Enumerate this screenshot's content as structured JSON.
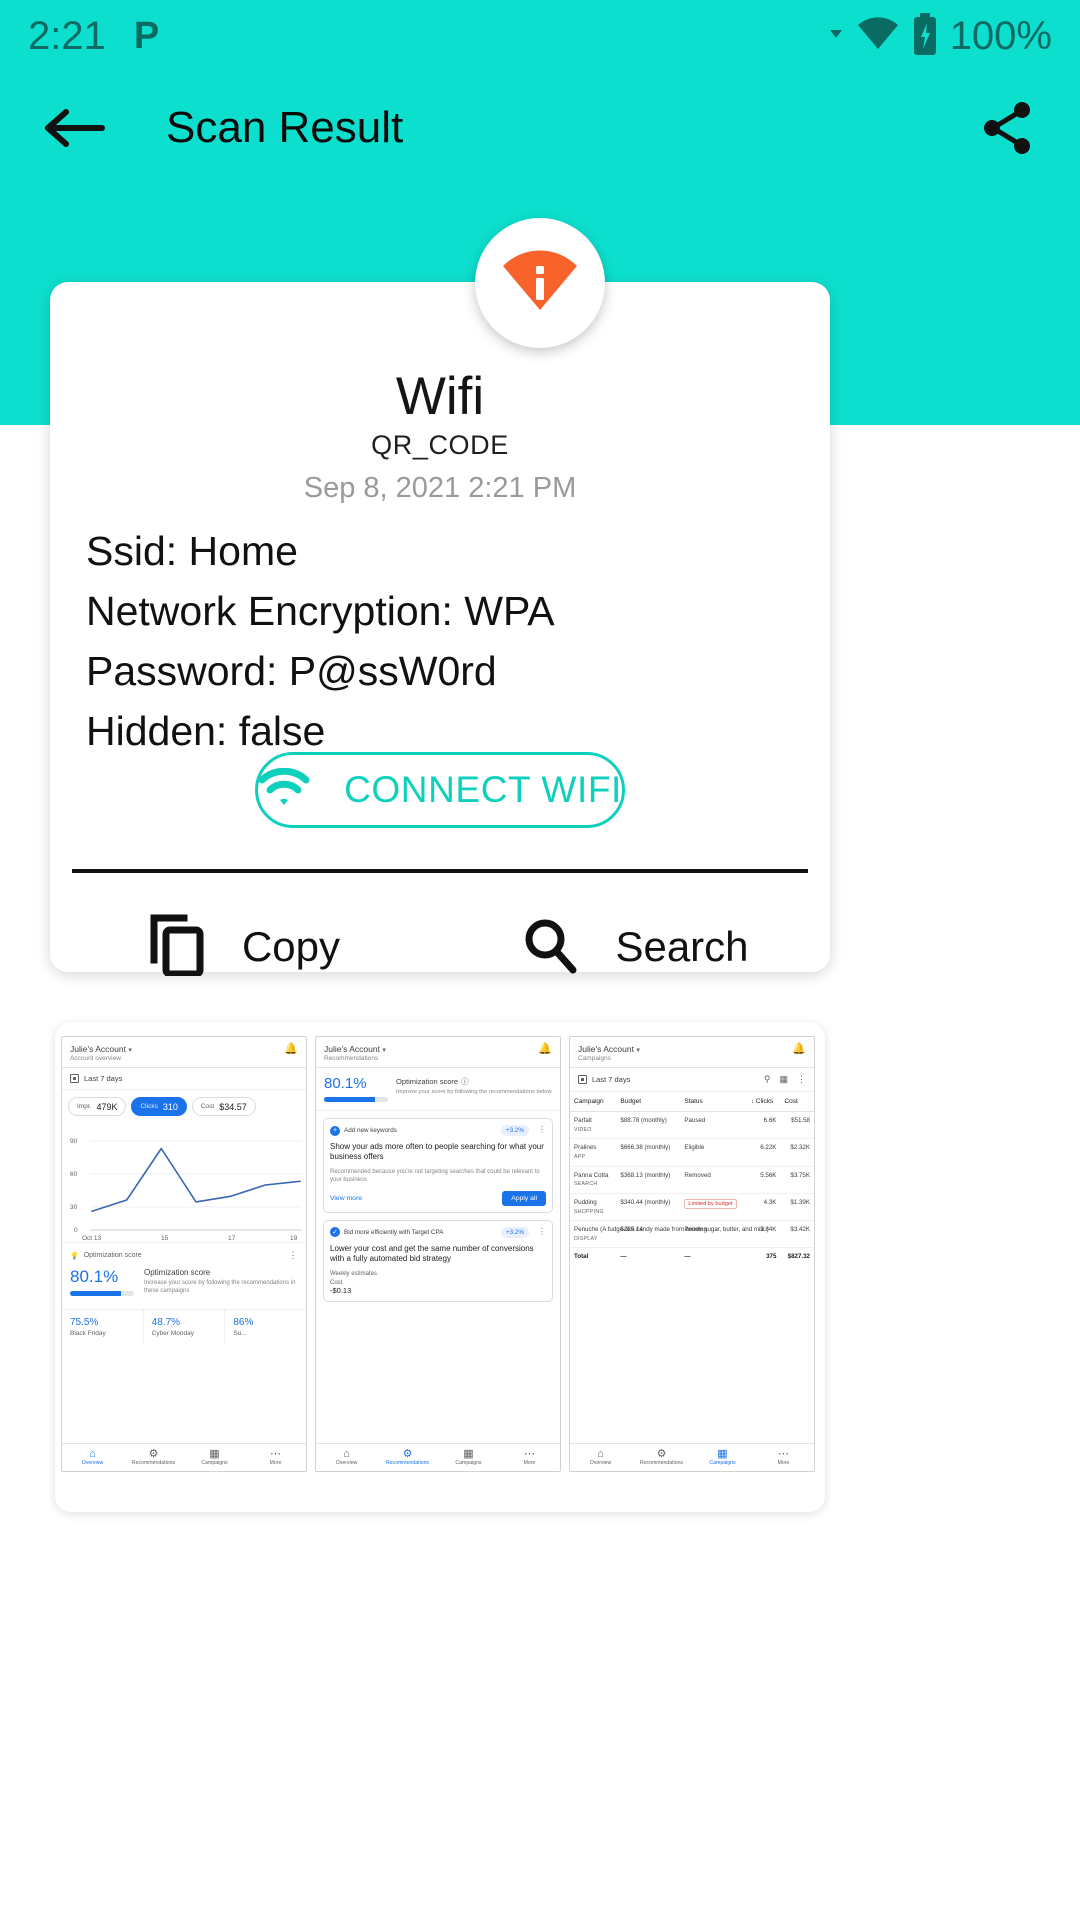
{
  "statusbar": {
    "time": "2:21",
    "app_icon": "P",
    "battery": "100%",
    "icons": [
      "wifi-icon",
      "battery-charging-icon"
    ]
  },
  "appbar": {
    "title": "Scan Result",
    "back_icon": "back-arrow-icon",
    "share_icon": "share-icon"
  },
  "result_card": {
    "badge_icon": "wifi-info-icon",
    "badge_color": "#f8632c",
    "title": "Wifi",
    "subtitle": "QR_CODE",
    "date": "Sep 8, 2021 2:21 PM",
    "details": [
      "Ssid: Home",
      "Network Encryption: WPA",
      "Password: P@ssW0rd",
      "Hidden: false"
    ],
    "connect_button": {
      "label": "CONNECT WIFI",
      "icon": "wifi-icon",
      "color": "#0ed0bc"
    },
    "actions": [
      {
        "label": "Copy",
        "icon": "copy-icon"
      },
      {
        "label": "Search",
        "icon": "search-icon"
      }
    ]
  },
  "promo": {
    "pane1": {
      "account": "Julie's Account",
      "caret": "▾",
      "section": "Account overview",
      "bell": "notifications-icon",
      "date_range": "Last 7 days",
      "chips": [
        {
          "label": "Impr.",
          "value": "479K",
          "active": false
        },
        {
          "label": "Clicks",
          "value": "310",
          "active": true
        },
        {
          "label": "Cost",
          "value": "$34.57",
          "active": false
        }
      ],
      "optimization": {
        "header": "Optimization score",
        "score": "80.1%",
        "title": "Optimization score",
        "desc": "Increase your score by following the recommendations in these campaigns",
        "bar_pct": 80
      },
      "tri": [
        {
          "pct": "75.5%",
          "name": "Black Friday"
        },
        {
          "pct": "48.7%",
          "name": "Cyber Monday"
        },
        {
          "pct": "86%",
          "name": "Su..."
        }
      ],
      "nav": [
        {
          "label": "Overview",
          "icon": "home-icon",
          "selected": true
        },
        {
          "label": "Recommendations",
          "icon": "bulb-icon",
          "selected": false
        },
        {
          "label": "Campaigns",
          "icon": "campaign-icon",
          "selected": false
        },
        {
          "label": "More",
          "icon": "more-icon",
          "selected": false
        }
      ]
    },
    "pane2": {
      "account": "Julie's Account",
      "section": "Recommendations",
      "score": "80.1%",
      "title": "Optimization score",
      "desc": "Improve your score by following the recommendations below",
      "cards": [
        {
          "label": "Add new keywords",
          "pct": "+3.2%",
          "title": "Show your ads more often to people searching for what your business offers",
          "body": "Recommended because you're not targeting searches that could be relevant to your business",
          "view": "View more",
          "apply": "Apply all"
        },
        {
          "label": "Bid more efficiently with Target CPA",
          "pct": "+3.2%",
          "title": "Lower your cost and get the same number of conversions with a fully automated bid strategy",
          "sub": "Weekly estimates",
          "cost_label": "Cost",
          "cost_value": "-$0.13"
        }
      ],
      "nav": [
        {
          "label": "Overview",
          "icon": "home-icon",
          "selected": false
        },
        {
          "label": "Recommendations",
          "icon": "bulb-icon",
          "selected": true
        },
        {
          "label": "Campaigns",
          "icon": "campaign-icon",
          "selected": false
        },
        {
          "label": "More",
          "icon": "more-icon",
          "selected": false
        }
      ]
    },
    "pane3": {
      "account": "Julie's Account",
      "section": "Campaigns",
      "date_range": "Last 7 days",
      "tools": [
        "search-icon",
        "columns-icon",
        "overflow-icon"
      ],
      "columns": [
        "Campaign",
        "Budget",
        "Status",
        "↓ Clicks",
        "Cost"
      ],
      "rows": [
        {
          "name": "Parfait",
          "type": "VIDEO",
          "budget": "$88.78 (monthly)",
          "status": "Paused",
          "status_kind": "paused",
          "clicks": "6.6K",
          "cost": "$51.58"
        },
        {
          "name": "Pralines",
          "type": "APP",
          "budget": "$666.38 (monthly)",
          "status": "Eligible",
          "status_kind": "eligible",
          "clicks": "6.22K",
          "cost": "$2.32K"
        },
        {
          "name": "Panna Cotta",
          "type": "SEARCH",
          "budget": "$368.13 (monthly)",
          "status": "Removed",
          "status_kind": "removed",
          "clicks": "5.56K",
          "cost": "$3.75K"
        },
        {
          "name": "Pudding",
          "type": "SHOPPING",
          "budget": "$340.44 (monthly)",
          "status": "Limited by budget",
          "status_kind": "limited",
          "clicks": "4.3K",
          "cost": "$1.39K"
        },
        {
          "name": "Penuche (A fudge-like candy made from brown sugar, butter, and milk.)",
          "type": "DISPLAY",
          "budget": "$225.14",
          "status": "Pending",
          "status_kind": "pending",
          "clicks": "2.84K",
          "cost": "$3.42K"
        }
      ],
      "total": {
        "label": "Total",
        "budget": "—",
        "status": "—",
        "clicks": "375",
        "cost": "$827.32"
      },
      "nav": [
        {
          "label": "Overview",
          "icon": "home-icon",
          "selected": false
        },
        {
          "label": "Recommendations",
          "icon": "bulb-icon",
          "selected": false
        },
        {
          "label": "Campaigns",
          "icon": "campaign-icon",
          "selected": true
        },
        {
          "label": "More",
          "icon": "more-icon",
          "selected": false
        }
      ]
    }
  },
  "chart_data": {
    "type": "line",
    "title": "",
    "xlabel": "",
    "ylabel": "",
    "x": [
      "Oct 13",
      "14",
      "15",
      "16",
      "17",
      "18",
      "19"
    ],
    "tick_labels": [
      "Oct 13",
      "15",
      "17",
      "19"
    ],
    "y_ticks": [
      0,
      30,
      60,
      90
    ],
    "ylim": [
      0,
      95
    ],
    "series": [
      {
        "name": "Clicks",
        "values": [
          20,
          32,
          87,
          30,
          36,
          48,
          52
        ],
        "color": "#3a66b0"
      }
    ],
    "grid": true,
    "legend": "none"
  }
}
